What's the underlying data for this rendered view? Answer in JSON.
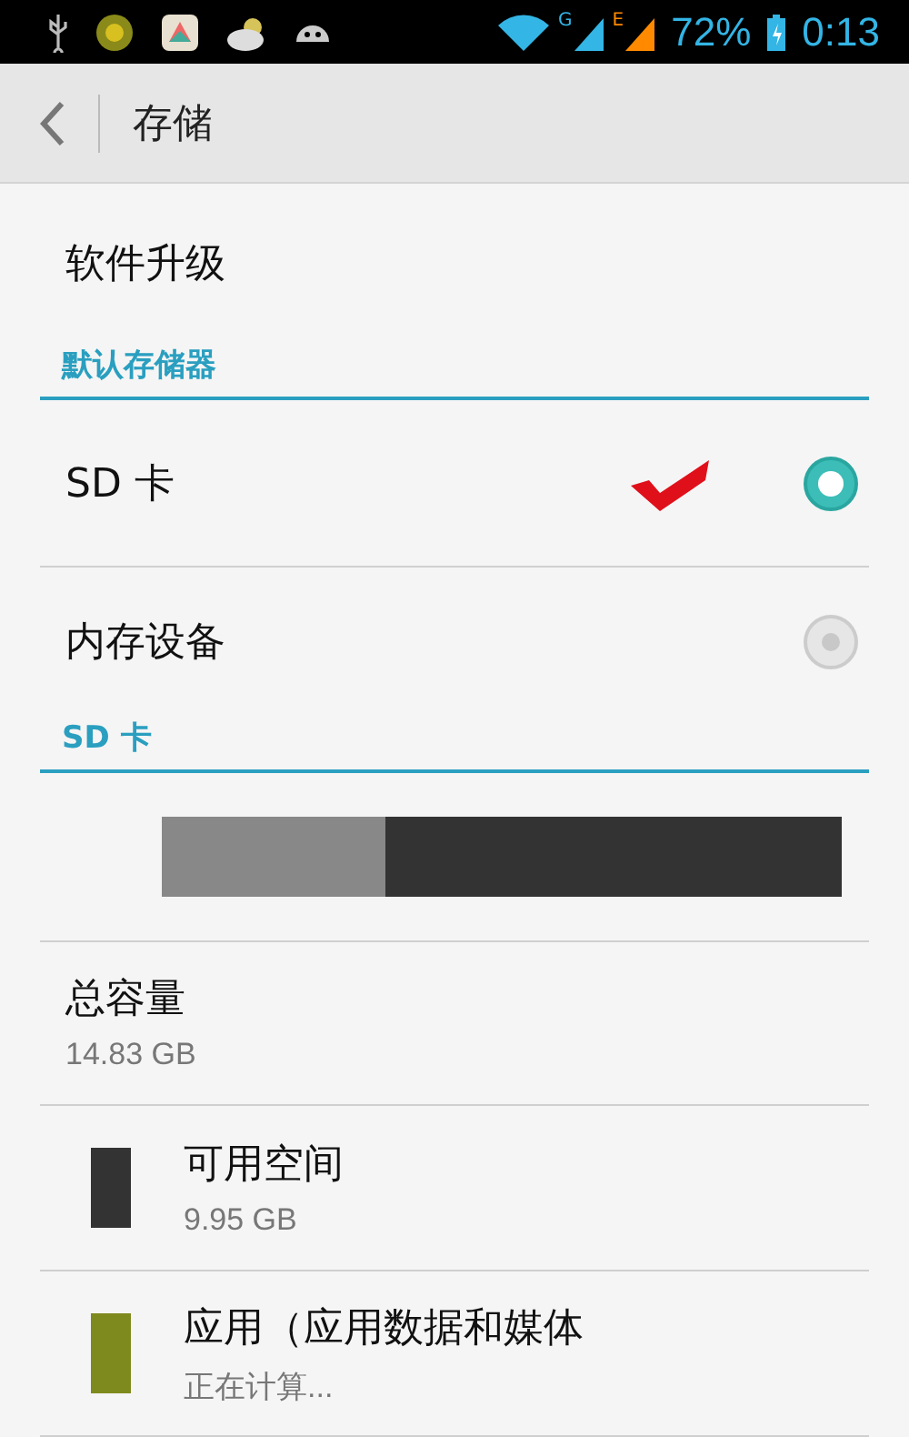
{
  "status_bar": {
    "network_labels": [
      "G",
      "E"
    ],
    "battery": "72%",
    "time": "0:13"
  },
  "action_bar": {
    "title": "存储"
  },
  "items": [
    {
      "kind": "plain",
      "label": "软件升级"
    },
    {
      "kind": "header",
      "label": "默认存储器"
    },
    {
      "kind": "radio",
      "label": "SD 卡",
      "selected": true,
      "marked": true
    },
    {
      "kind": "radio",
      "label": "内存设备",
      "selected": false,
      "marked": false
    },
    {
      "kind": "header",
      "label": "SD 卡"
    },
    {
      "kind": "bar",
      "level": 0.33,
      "color": "#888888"
    },
    {
      "kind": "info",
      "label": "总容量",
      "value": "14.83 GB"
    },
    {
      "kind": "legend",
      "label": "可用空间",
      "value": "9.95 GB",
      "color": "#333333"
    },
    {
      "kind": "legend",
      "label": "应用（应用数据和媒体",
      "value": "正在计算...",
      "color": "#7f8a1e"
    }
  ]
}
